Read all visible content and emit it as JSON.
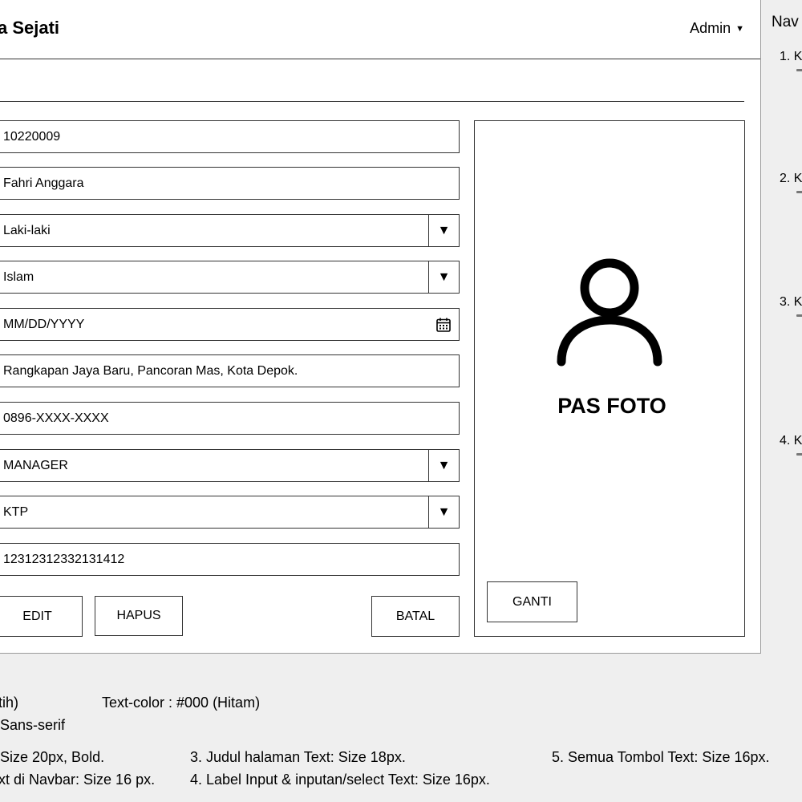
{
  "navbar": {
    "brand": "a Sejati",
    "admin_label": "Admin"
  },
  "form": {
    "id_value": "10220009",
    "name_value": "Fahri Anggara",
    "gender_value": "Laki-laki",
    "religion_value": "Islam",
    "date_placeholder": "MM/DD/YYYY",
    "address_value": "Rangkapan Jaya Baru, Pancoran Mas, Kota Depok.",
    "phone_value": "0896-XXXX-XXXX",
    "position_value": "MANAGER",
    "id_type_value": "KTP",
    "id_number_value": "12312312332131412"
  },
  "buttons": {
    "edit": "EDIT",
    "delete": "HAPUS",
    "cancel": "BATAL",
    "change_photo": "GANTI"
  },
  "photo": {
    "label": "PAS FOTO"
  },
  "side_panel": {
    "title": "Nav",
    "items": [
      "1. K",
      "2. K",
      "3. K",
      "4. K"
    ]
  },
  "notes": {
    "bg_fragment": "tih)",
    "text_color": "Text-color  : #000 (Hitam)",
    "font_fragment": "Sans-serif",
    "item1_fragment": "Size 20px, Bold.",
    "item2_fragment": "xt di Navbar:  Size 16 px.",
    "item3": "3. Judul halaman Text: Size 18px.",
    "item4": "4. Label Input & inputan/select Text: Size 16px.",
    "item5": "5. Semua Tombol Text: Size 16px."
  },
  "icons": {
    "dropdown": "triangle-down-icon",
    "calendar": "calendar-icon",
    "user": "user-icon",
    "caret": "caret-down-icon"
  }
}
